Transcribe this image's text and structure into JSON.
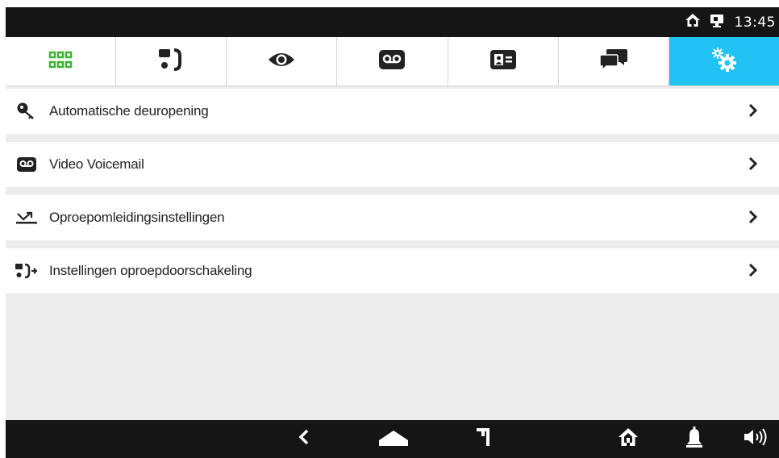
{
  "status_bar": {
    "time": "13:45",
    "icons": [
      "home-icon",
      "intercom-monitor-icon"
    ]
  },
  "tabs": [
    {
      "name": "apps",
      "icon": "apps-grid-icon",
      "active": false
    },
    {
      "name": "intercom",
      "icon": "intercom-call-icon",
      "active": false
    },
    {
      "name": "monitor",
      "icon": "eye-icon",
      "active": false
    },
    {
      "name": "voicemail",
      "icon": "voicemail-icon",
      "active": false
    },
    {
      "name": "contacts",
      "icon": "contact-card-icon",
      "active": false
    },
    {
      "name": "messages",
      "icon": "chat-bubbles-icon",
      "active": false
    },
    {
      "name": "settings",
      "icon": "settings-gears-icon",
      "active": true
    }
  ],
  "menu": {
    "items": [
      {
        "label": "Automatische deuropening",
        "icon": "key-icon"
      },
      {
        "label": "Video Voicemail",
        "icon": "voicemail-icon"
      },
      {
        "label": "Oproepomleidingsinstellingen",
        "icon": "call-diversion-icon"
      },
      {
        "label": "Instellingen oproepdoorschakeling",
        "icon": "call-forward-icon"
      }
    ]
  },
  "nav_bar": {
    "buttons": [
      "back-icon",
      "home-icon",
      "recent-icon",
      "house-icon",
      "bell-icon",
      "speaker-icon"
    ]
  },
  "colors": {
    "accent": "#22c3f4",
    "apps_green": "#3cb531",
    "bar_dark": "#151515",
    "icon_dark": "#222222"
  }
}
